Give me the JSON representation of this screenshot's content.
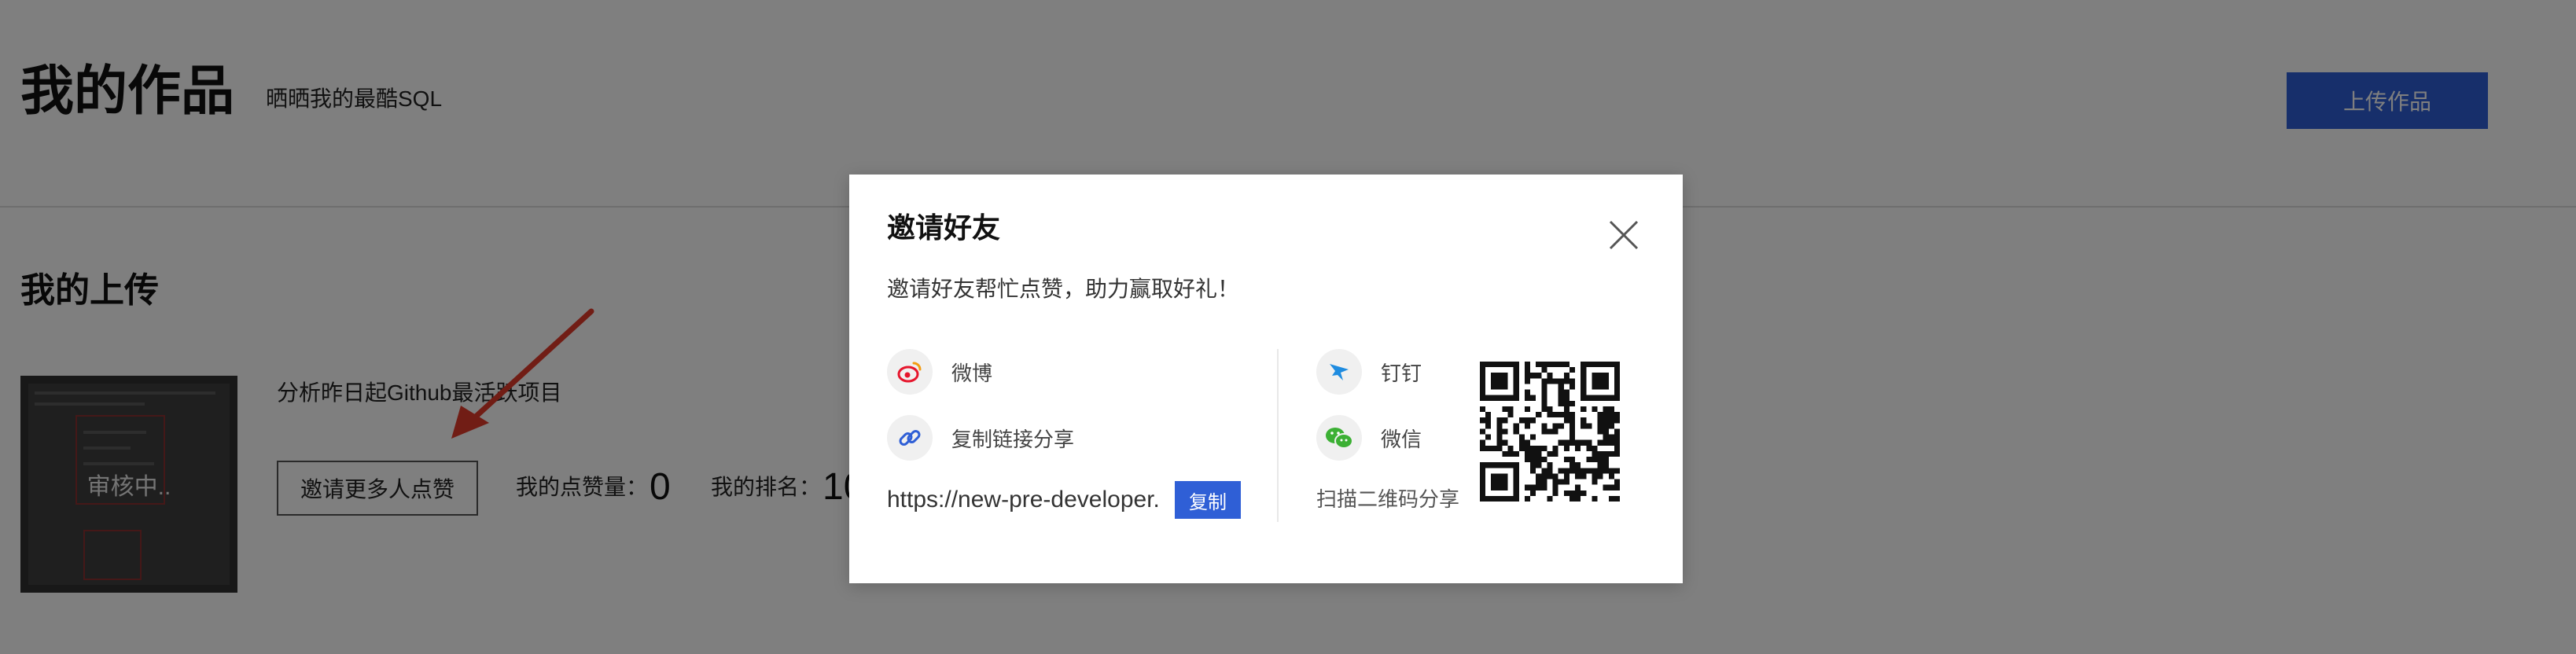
{
  "header": {
    "title": "我的作品",
    "subtitle": "晒晒我的最酷SQL",
    "upload_label": "上传作品"
  },
  "uploads": {
    "section_title": "我的上传",
    "item": {
      "status_overlay": "审核中..",
      "title": "分析昨日起Github最活跃项目",
      "invite_label": "邀请更多人点赞",
      "likes_label": "我的点赞量：",
      "likes_value": "0",
      "rank_label": "我的排名：",
      "rank_value": "10"
    }
  },
  "invite_modal": {
    "title": "邀请好友",
    "description": "邀请好友帮忙点赞，助力赢取好礼！",
    "share_options": [
      {
        "label": "微博",
        "icon": "weibo-icon",
        "color": "#e6162d"
      },
      {
        "label": "复制链接分享",
        "icon": "link-icon",
        "color": "#2f5fd6"
      },
      {
        "label": "钉钉",
        "icon": "dingtalk-icon",
        "color": "#1f8ce0"
      },
      {
        "label": "微信",
        "icon": "wechat-icon",
        "color": "#3cb034"
      }
    ],
    "share_url": "https://new-pre-developer.",
    "copy_label": "复制",
    "qr_caption": "扫描二维码分享"
  },
  "colors": {
    "primary": "#2f5fd6",
    "overlay": "rgba(0,0,0,0.5)",
    "annotation_arrow": "#e23a2a"
  }
}
